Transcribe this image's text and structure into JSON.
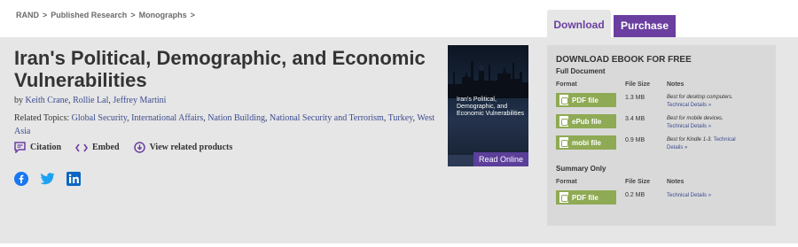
{
  "breadcrumb": {
    "items": [
      "RAND",
      "Published Research",
      "Monographs"
    ],
    "separator": ">"
  },
  "title": "Iran's Political, Demographic, and Economic Vulnerabilities",
  "byline": {
    "prefix": "by",
    "authors": [
      "Keith Crane",
      "Rollie Lal",
      "Jeffrey Martini"
    ]
  },
  "topics": {
    "label": "Related Topics:",
    "items": [
      "Global Security",
      "International Affairs",
      "Nation Building",
      "National Security and Terrorism",
      "Turkey",
      "West Asia"
    ]
  },
  "actions": {
    "citation": "Citation",
    "embed": "Embed",
    "related": "View related products"
  },
  "social": {
    "icons": [
      "facebook-icon",
      "twitter-icon",
      "linkedin-icon"
    ],
    "colors": {
      "facebook": "#1877f2",
      "twitter": "#1da1f2",
      "linkedin": "#0a66c2"
    }
  },
  "cover": {
    "title": "Iran's Political, Demographic, and Economic Vulnerabilities",
    "read_online": "Read Online"
  },
  "tabs": {
    "download": "Download",
    "purchase": "Purchase"
  },
  "download_panel": {
    "heading": "DOWNLOAD EBOOK FOR FREE",
    "full_document": {
      "label": "Full Document",
      "columns": [
        "Format",
        "File Size",
        "Notes"
      ],
      "rows": [
        {
          "format": "PDF file",
          "size": "1.3 MB",
          "note": "Best for desktop computers.",
          "link": "Technical Details »"
        },
        {
          "format": "ePub file",
          "size": "3.4 MB",
          "note": "Best for mobile devices.",
          "link": "Technical Details »"
        },
        {
          "format": "mobi file",
          "size": "0.9 MB",
          "note": "Best for Kindle 1-3.",
          "link": "Technical Details »"
        }
      ]
    },
    "summary_only": {
      "label": "Summary Only",
      "columns": [
        "Format",
        "File Size",
        "Notes"
      ],
      "rows": [
        {
          "format": "PDF file",
          "size": "0.2 MB",
          "note": "",
          "link": "Technical Details »"
        }
      ]
    }
  },
  "colors": {
    "accent_purple": "#6b3fa0",
    "link_blue": "#3c4c8f",
    "file_button_green": "#8faa55",
    "panel_gray": "#e6e6e6"
  }
}
